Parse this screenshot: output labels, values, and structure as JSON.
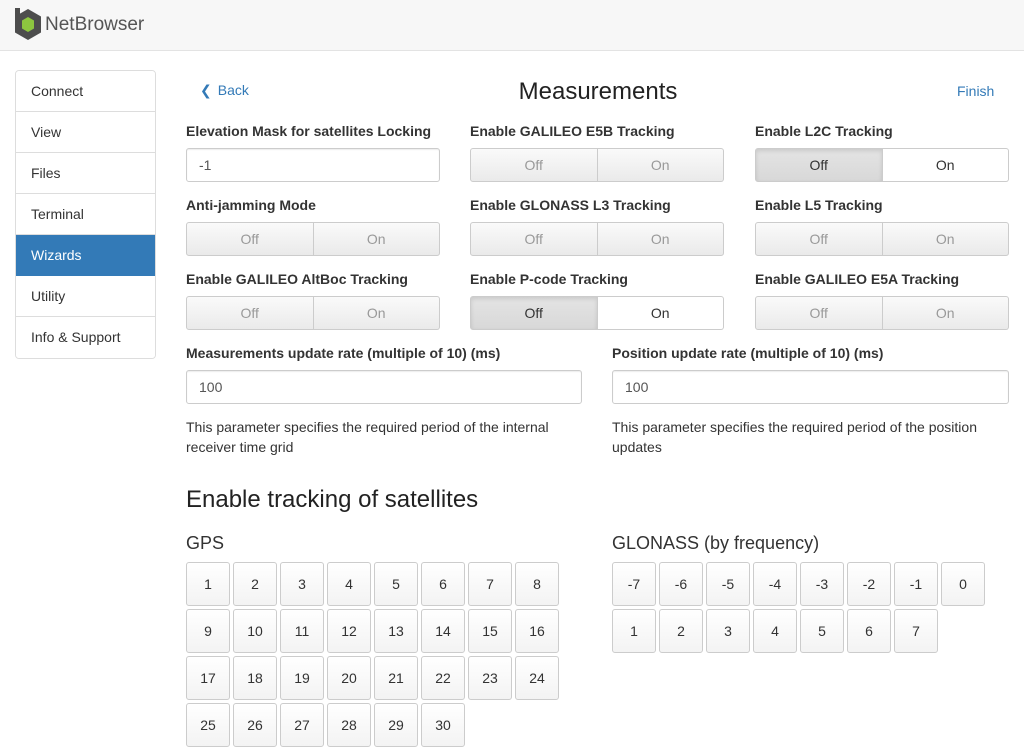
{
  "app": {
    "name": "NetBrowser"
  },
  "sidebar": {
    "items": [
      {
        "label": "Connect"
      },
      {
        "label": "View"
      },
      {
        "label": "Files"
      },
      {
        "label": "Terminal"
      },
      {
        "label": "Wizards",
        "active": true
      },
      {
        "label": "Utility"
      },
      {
        "label": "Info & Support"
      }
    ]
  },
  "header": {
    "back_label": "Back",
    "title": "Measurements",
    "finish_label": "Finish"
  },
  "fields": {
    "elevation_mask": {
      "label": "Elevation Mask for satellites Locking",
      "value": "-1"
    },
    "galileo_e5b": {
      "label": "Enable GALILEO E5B Tracking",
      "off": "Off",
      "on": "On"
    },
    "l2c": {
      "label": "Enable L2C Tracking",
      "off": "Off",
      "on": "On",
      "selected": "Off"
    },
    "anti_jamming": {
      "label": "Anti-jamming Mode",
      "off": "Off",
      "on": "On"
    },
    "glonass_l3": {
      "label": "Enable GLONASS L3 Tracking",
      "off": "Off",
      "on": "On"
    },
    "l5": {
      "label": "Enable L5 Tracking",
      "off": "Off",
      "on": "On"
    },
    "galileo_altboc": {
      "label": "Enable GALILEO AltBoc Tracking",
      "off": "Off",
      "on": "On"
    },
    "pcode": {
      "label": "Enable P-code Tracking",
      "off": "Off",
      "on": "On",
      "selected": "Off"
    },
    "galileo_e5a": {
      "label": "Enable GALILEO E5A Tracking",
      "off": "Off",
      "on": "On"
    },
    "meas_rate": {
      "label": "Measurements update rate (multiple of 10) (ms)",
      "value": "100",
      "help": "This parameter specifies the required period of the internal receiver time grid"
    },
    "pos_rate": {
      "label": "Position update rate (multiple of 10) (ms)",
      "value": "100",
      "help": "This parameter specifies the required period of the position updates"
    }
  },
  "satellites": {
    "title": "Enable tracking of satellites",
    "gps": {
      "title": "GPS",
      "items": [
        "1",
        "2",
        "3",
        "4",
        "5",
        "6",
        "7",
        "8",
        "9",
        "10",
        "11",
        "12",
        "13",
        "14",
        "15",
        "16",
        "17",
        "18",
        "19",
        "20",
        "21",
        "22",
        "23",
        "24",
        "25",
        "26",
        "27",
        "28",
        "29",
        "30"
      ]
    },
    "glonass": {
      "title": "GLONASS (by frequency)",
      "items": [
        "-7",
        "-6",
        "-5",
        "-4",
        "-3",
        "-2",
        "-1",
        "0",
        "1",
        "2",
        "3",
        "4",
        "5",
        "6",
        "7"
      ]
    }
  },
  "colors": {
    "accent": "#337ab7",
    "logo_hex": "#5a7a2a"
  }
}
